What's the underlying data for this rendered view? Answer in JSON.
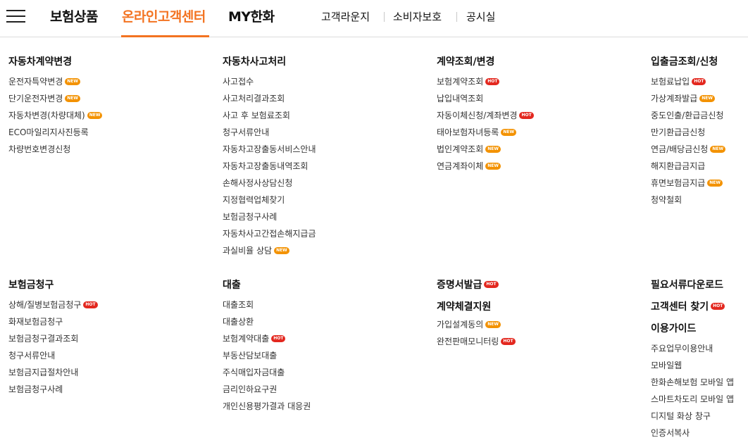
{
  "header": {
    "menu_icon": "hamburger-menu-icon",
    "main_nav": [
      "보험상품",
      "온라인고객센터",
      "MY한화"
    ],
    "active_index": 1,
    "sub_nav": [
      "고객라운지",
      "소비자보호",
      "공시실"
    ],
    "accent_color": "#f37321"
  },
  "sections": {
    "car_contract": {
      "title": "자동차계약변경",
      "items": [
        {
          "label": "운전자특약변경",
          "badge": "NEW"
        },
        {
          "label": "단기운전자변경",
          "badge": "NEW"
        },
        {
          "label": "자동차변경(차량대체)",
          "badge": "NEW"
        },
        {
          "label": "ECO마일리지사진등록",
          "badge": ""
        },
        {
          "label": "차량번호변경신청",
          "badge": ""
        }
      ]
    },
    "car_accident": {
      "title": "자동차사고처리",
      "items": [
        {
          "label": "사고접수",
          "badge": ""
        },
        {
          "label": "사고처리결과조회",
          "badge": ""
        },
        {
          "label": "사고 후 보험료조회",
          "badge": ""
        },
        {
          "label": "청구서류안내",
          "badge": ""
        },
        {
          "label": "자동차고장출동서비스안내",
          "badge": ""
        },
        {
          "label": "자동차고장출동내역조회",
          "badge": ""
        },
        {
          "label": "손해사정사상담신청",
          "badge": ""
        },
        {
          "label": "지정협력업체찾기",
          "badge": ""
        },
        {
          "label": "보험금청구사례",
          "badge": ""
        },
        {
          "label": "자동차사고간접손해지급금",
          "badge": ""
        },
        {
          "label": "과실비율 상담",
          "badge": "NEW"
        }
      ]
    },
    "contract_inquiry": {
      "title": "계약조회/변경",
      "items": [
        {
          "label": "보험계약조회",
          "badge": "HOT"
        },
        {
          "label": "납입내역조회",
          "badge": ""
        },
        {
          "label": "자동이체신청/계좌변경",
          "badge": "HOT"
        },
        {
          "label": "태아보험자녀등록",
          "badge": "NEW"
        },
        {
          "label": "법인계약조회",
          "badge": "NEW"
        },
        {
          "label": "연금계좌이체",
          "badge": "NEW"
        }
      ]
    },
    "payment": {
      "title": "입출금조회/신청",
      "items": [
        {
          "label": "보험료납입",
          "badge": "HOT"
        },
        {
          "label": "가상계좌발급",
          "badge": "NEW"
        },
        {
          "label": "중도인출/환급금신청",
          "badge": ""
        },
        {
          "label": "만기환급금신청",
          "badge": ""
        },
        {
          "label": "연금/배당금신청",
          "badge": "NEW"
        },
        {
          "label": "해지환급금지급",
          "badge": ""
        },
        {
          "label": "휴면보험금지급",
          "badge": "NEW"
        },
        {
          "label": "청약철회",
          "badge": ""
        }
      ]
    },
    "claim": {
      "title": "보험금청구",
      "items": [
        {
          "label": "상해/질병보험금청구",
          "badge": "HOT"
        },
        {
          "label": "화재보험금청구",
          "badge": ""
        },
        {
          "label": "보험금청구결과조회",
          "badge": ""
        },
        {
          "label": "청구서류안내",
          "badge": ""
        },
        {
          "label": "보험금지급절차안내",
          "badge": ""
        },
        {
          "label": "보험금청구사례",
          "badge": ""
        }
      ]
    },
    "loan": {
      "title": "대출",
      "items": [
        {
          "label": "대출조회",
          "badge": ""
        },
        {
          "label": "대출상환",
          "badge": ""
        },
        {
          "label": "보험계약대출",
          "badge": "HOT"
        },
        {
          "label": "부동산담보대출",
          "badge": ""
        },
        {
          "label": "주식매입자금대출",
          "badge": ""
        },
        {
          "label": "금리인하요구권",
          "badge": ""
        },
        {
          "label": "개인신용평가결과 대응권",
          "badge": ""
        }
      ]
    },
    "certificate": {
      "title": "증명서발급",
      "badge": "HOT"
    },
    "signing": {
      "title": "계약체결지원",
      "items": [
        {
          "label": "가입설계동의",
          "badge": "NEW"
        },
        {
          "label": "완전판매모니터링",
          "badge": "HOT"
        }
      ]
    },
    "docs_download": {
      "title": "필요서류다운로드"
    },
    "find_center": {
      "title": "고객센터 찾기",
      "badge": "HOT"
    },
    "usage_guide": {
      "title": "이용가이드",
      "items": [
        {
          "label": "주요업무이용안내",
          "badge": ""
        },
        {
          "label": "모바일웹",
          "badge": ""
        },
        {
          "label": "한화손해보험 모바일 앱",
          "badge": ""
        },
        {
          "label": "스마트차도리 모바일 앱",
          "badge": ""
        },
        {
          "label": "디지털 화상 창구",
          "badge": ""
        },
        {
          "label": "인증서복사",
          "badge": ""
        }
      ]
    }
  },
  "badge_colors": {
    "NEW": "#f39200",
    "HOT": "#e3281f"
  }
}
